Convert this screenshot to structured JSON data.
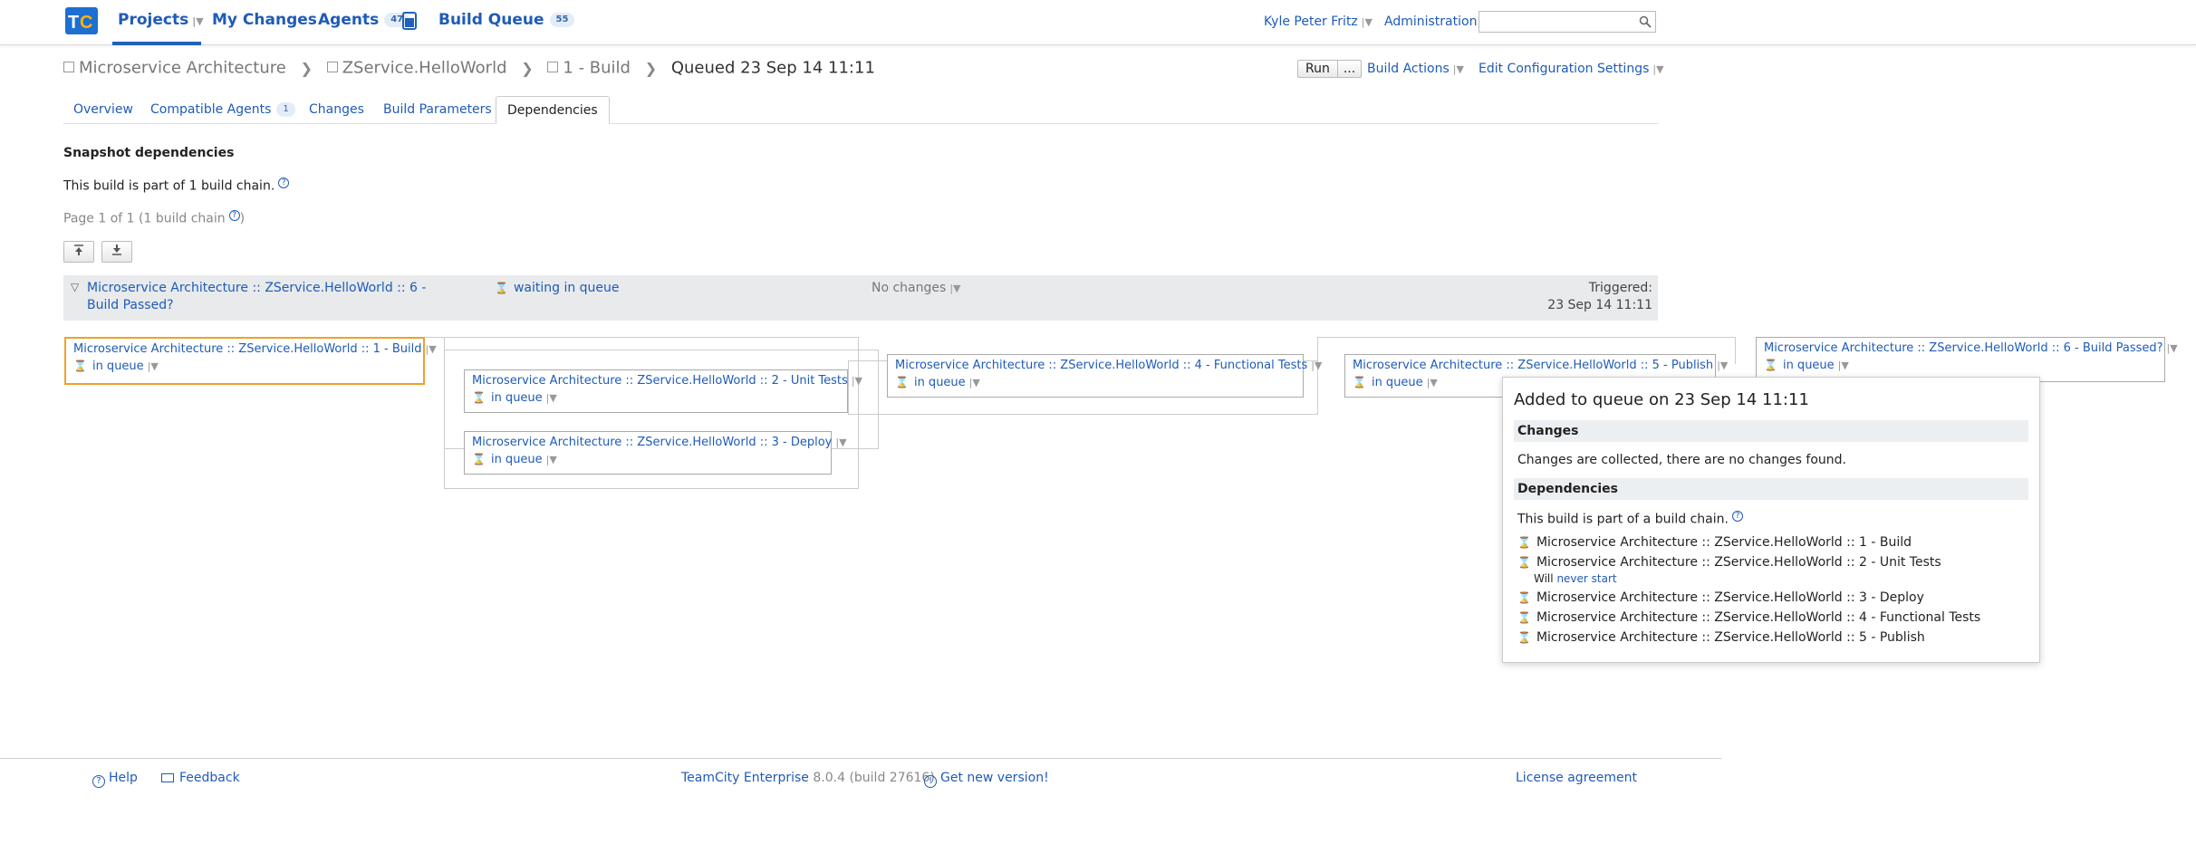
{
  "topnav": {
    "projects": "Projects",
    "my_changes": "My Changes",
    "agents": "Agents",
    "agents_count": "47",
    "build_queue": "Build Queue",
    "build_queue_count": "55",
    "user": "Kyle Peter Fritz",
    "administration": "Administration",
    "search_value": ""
  },
  "breadcrumb": {
    "project": "Microservice Architecture",
    "subproject": "ZService.HelloWorld",
    "build_config": "1 - Build",
    "current": "Queued 23 Sep 14 11:11"
  },
  "actions": {
    "run": "Run",
    "run_more": "...",
    "build_actions": "Build Actions",
    "edit_config": "Edit Configuration Settings"
  },
  "tabs": {
    "overview": "Overview",
    "compatible_agents": "Compatible Agents",
    "compatible_agents_count": "1",
    "changes": "Changes",
    "build_parameters": "Build Parameters",
    "dependencies": "Dependencies"
  },
  "content": {
    "section_title": "Snapshot dependencies",
    "chain_info": "This build is part of 1 build chain.",
    "page_info": "Page 1 of 1 (1 build chain",
    "page_info_end": ")"
  },
  "chain_summary": {
    "name_line1": "Microservice Architecture :: ZService.HelloWorld :: 6 -",
    "name_line2": "Build Passed?",
    "status": "waiting in queue",
    "changes": "No changes",
    "triggered_label": "Triggered:",
    "triggered_date": "23 Sep 14 11:11"
  },
  "nodes": [
    {
      "name": "Microservice Architecture :: ZService.HelloWorld :: 1 - Build",
      "status": "in queue"
    },
    {
      "name": "Microservice Architecture :: ZService.HelloWorld :: 2 - Unit Tests",
      "status": "in queue"
    },
    {
      "name": "Microservice Architecture :: ZService.HelloWorld :: 3 - Deploy",
      "status": "in queue"
    },
    {
      "name": "Microservice Architecture :: ZService.HelloWorld :: 4 - Functional Tests",
      "status": "in queue"
    },
    {
      "name": "Microservice Architecture :: ZService.HelloWorld :: 5 - Publish",
      "status": "in queue"
    },
    {
      "name": "Microservice Architecture :: ZService.HelloWorld :: 6 - Build Passed?",
      "status": "in queue"
    }
  ],
  "popup": {
    "title": "Added to queue on 23 Sep 14 11:11",
    "changes_head": "Changes",
    "changes_text": "Changes are collected, there are no changes found.",
    "deps_head": "Dependencies",
    "deps_text": "This build is part of a build chain.",
    "deps": [
      "Microservice Architecture :: ZService.HelloWorld :: 1 - Build",
      "Microservice Architecture :: ZService.HelloWorld :: 2 - Unit Tests",
      "Microservice Architecture :: ZService.HelloWorld :: 3 - Deploy",
      "Microservice Architecture :: ZService.HelloWorld :: 4 - Functional Tests",
      "Microservice Architecture :: ZService.HelloWorld :: 5 - Publish"
    ],
    "will_text": "Will",
    "never_start": "never start"
  },
  "footer": {
    "help": "Help",
    "feedback": "Feedback",
    "product": "TeamCity Enterprise",
    "version": "8.0.4 (build 27616)",
    "new_version": "Get new version!",
    "license": "License agreement"
  }
}
